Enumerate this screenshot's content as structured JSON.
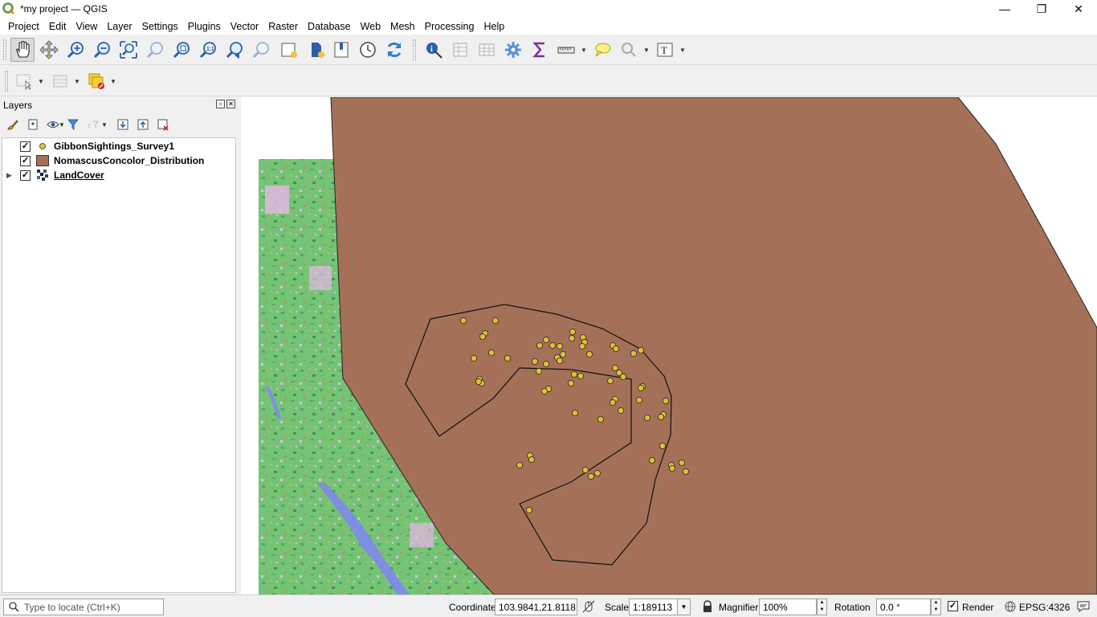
{
  "window": {
    "title": "*my project — QGIS",
    "minimize": "—",
    "maximize": "❐",
    "close": "✕"
  },
  "menu": [
    "Project",
    "Edit",
    "View",
    "Layer",
    "Settings",
    "Plugins",
    "Vector",
    "Raster",
    "Database",
    "Web",
    "Mesh",
    "Processing",
    "Help"
  ],
  "toolbar": {
    "icons": [
      "pan-map-icon",
      "pan-to-selection-icon",
      "zoom-in-icon",
      "zoom-out-icon",
      "zoom-full-icon",
      "zoom-to-selection-icon",
      "zoom-to-layer-icon",
      "zoom-native-icon",
      "zoom-last-icon",
      "zoom-next-icon",
      "new-map-view-icon",
      "new-3d-map-view-icon",
      "new-bookmark-icon",
      "temporal-controller-icon",
      "refresh-icon",
      "identify-features-icon",
      "open-attribute-table-icon",
      "open-field-calculator-icon",
      "toolbox-icon",
      "statistical-summary-icon",
      "measure-icon",
      "map-tips-icon",
      "select-by-location-icon",
      "text-annotation-icon"
    ]
  },
  "layers_panel": {
    "title": "Layers",
    "layers": [
      {
        "name": "GibbonSightings_Survey1",
        "checked": true,
        "symbol": "point",
        "expandable": false
      },
      {
        "name": "NomascusConcolor_Distribution",
        "checked": true,
        "symbol": "polygon",
        "expandable": false
      },
      {
        "name": "LandCover",
        "checked": true,
        "symbol": "raster",
        "expandable": true
      }
    ]
  },
  "colors": {
    "polygon_fill": "#a47158",
    "point_fill": "#e0c030",
    "landcover_forest": "#74c476",
    "landcover_water": "#7f8fe0",
    "landcover_urban": "#e8b8e8"
  },
  "statusbar": {
    "locate_placeholder": "Type to locate (Ctrl+K)",
    "coordinate_label": "Coordinate",
    "coordinate_value": "103.9841,21.8118",
    "scale_label": "Scale",
    "scale_value": "1:189113",
    "magnifier_label": "Magnifier",
    "magnifier_value": "100%",
    "rotation_label": "Rotation",
    "rotation_value": "0.0 °",
    "render_label": "Render",
    "crs": "EPSG:4326"
  }
}
